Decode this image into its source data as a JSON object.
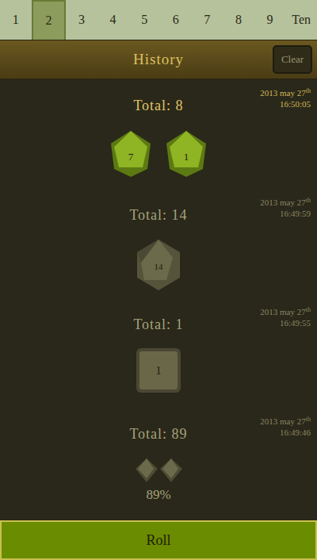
{
  "tabs": [
    {
      "label": "1",
      "selected": false
    },
    {
      "label": "2",
      "selected": true
    },
    {
      "label": "3",
      "selected": false
    },
    {
      "label": "4",
      "selected": false
    },
    {
      "label": "5",
      "selected": false
    },
    {
      "label": "6",
      "selected": false
    },
    {
      "label": "7",
      "selected": false
    },
    {
      "label": "8",
      "selected": false
    },
    {
      "label": "9",
      "selected": false
    },
    {
      "label": "Ten",
      "selected": false
    }
  ],
  "header": {
    "title": "History",
    "clear_button": "Clear"
  },
  "entries": [
    {
      "total": "Total: 8",
      "date": "2013 may 27",
      "suffix": "th",
      "time": "16:50:05",
      "latest": true,
      "kind": "d10",
      "dice": [
        "7",
        "1"
      ],
      "pieces": 0,
      "result": ""
    },
    {
      "total": "Total: 14",
      "date": "2013 may 27",
      "suffix": "th",
      "time": "16:49:59",
      "latest": false,
      "kind": "d20",
      "dice": [
        "14"
      ],
      "pieces": 0,
      "result": ""
    },
    {
      "total": "Total: 1",
      "date": "2013 may 27",
      "suffix": "th",
      "time": "16:49:55",
      "latest": false,
      "kind": "d6",
      "dice": [
        "1"
      ],
      "pieces": 0,
      "result": ""
    },
    {
      "total": "Total: 89",
      "date": "2013 may 27",
      "suffix": "th",
      "time": "16:49:46",
      "latest": false,
      "kind": "percent",
      "dice": [],
      "pieces": 2,
      "result": "89%"
    }
  ],
  "roll_button": "Roll"
}
